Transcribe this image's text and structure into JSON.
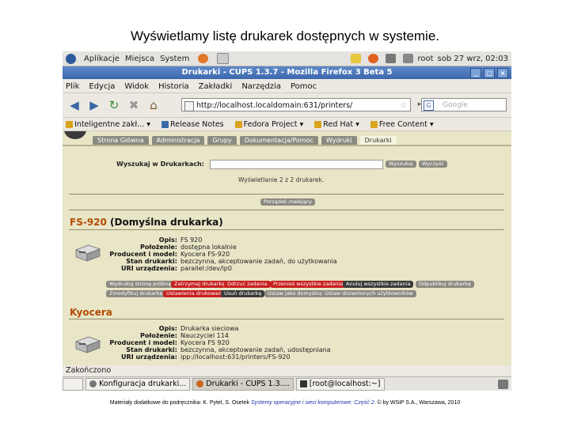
{
  "slide": {
    "title": "Wyświetlamy listę drukarek dostępnych w systemie.",
    "footer_prefix": "Materiały dodatkowe do podręcznika: K. Pytel, S. Osetek",
    "footer_italic": "Systemy operacyjne i sieci komputerowe. Część 2",
    "footer_suffix": ". © by WSiP S.A., Warszawa, 2010"
  },
  "gnome": {
    "menus": [
      "Aplikacje",
      "Miejsca",
      "System"
    ],
    "user": "root",
    "clock": "sob 27 wrz, 02:03"
  },
  "window": {
    "title": "Drukarki - CUPS 1.3.7 - Mozilla Firefox 3 Beta 5",
    "menu": [
      "Plik",
      "Edycja",
      "Widok",
      "Historia",
      "Zakładki",
      "Narzędzia",
      "Pomoc"
    ],
    "url": "http://localhost.localdomain:631/printers/",
    "search_placeholder": "Google",
    "bookmarks": [
      "Inteligentne zakł... ▾",
      "Release Notes",
      "Fedora Project ▾",
      "Red Hat ▾",
      "Free Content ▾"
    ],
    "status": "Zakończono"
  },
  "cups": {
    "tabs": [
      "Strona Główna",
      "Administracja",
      "Grupy",
      "Dokumentacja/Pomoc",
      "Wydruki",
      "Drukarki"
    ],
    "search_label": "Wyszukaj w Drukarkach:",
    "search_btn": "Wyszukaj",
    "clear_btn": "Wyczyść",
    "count_text": "Wyświetlanie 2 z 2 drukarek.",
    "sort_btn": "Porządek malejący",
    "printers": [
      {
        "name": "FS-920",
        "default_label": " (Domyślna drukarka)",
        "fields": [
          {
            "k": "Opis:",
            "v": "FS 920"
          },
          {
            "k": "Położenie:",
            "v": "dostępna lokalnie"
          },
          {
            "k": "Producent i model:",
            "v": "Kyocera FS-920"
          },
          {
            "k": "Stan drukarki:",
            "v": "bezczynna, akceptowanie zadań, do użytkowania"
          },
          {
            "k": "URI urządzenia:",
            "v": "parallel:/dev/lp0"
          }
        ],
        "actions_row1": [
          "Wydrukuj stronę próbną",
          "Zatrzymaj drukarkę",
          "Odrzuć zadania",
          "Przenieś wszystkie zadania",
          "Anuluj wszystkie zadania",
          "Odpublikuj drukarkę"
        ],
        "actions_row2": [
          "Zmodyfikuj drukarkę",
          "Ustawienia drukowania",
          "Usuń drukarkę",
          "Ustaw jako domyślną",
          "Ustaw dozwolonych użytkowników"
        ]
      },
      {
        "name": "Kyocera",
        "fields": [
          {
            "k": "Opis:",
            "v": "Drukarka sieciowa"
          },
          {
            "k": "Położenie:",
            "v": "Nauczyciel 114"
          },
          {
            "k": "Producent i model:",
            "v": "Kyocera FS 920"
          },
          {
            "k": "Stan drukarki:",
            "v": "bezczynna, akceptowanie zadań, udostępniana"
          },
          {
            "k": "URI urządzenia:",
            "v": "ipp://localhost:631/printers/FS-920"
          }
        ]
      }
    ]
  },
  "taskbar": {
    "tasks": [
      "Konfiguracja drukarki...",
      "Drukarki - CUPS 1.3....",
      "[root@localhost:~]"
    ]
  }
}
